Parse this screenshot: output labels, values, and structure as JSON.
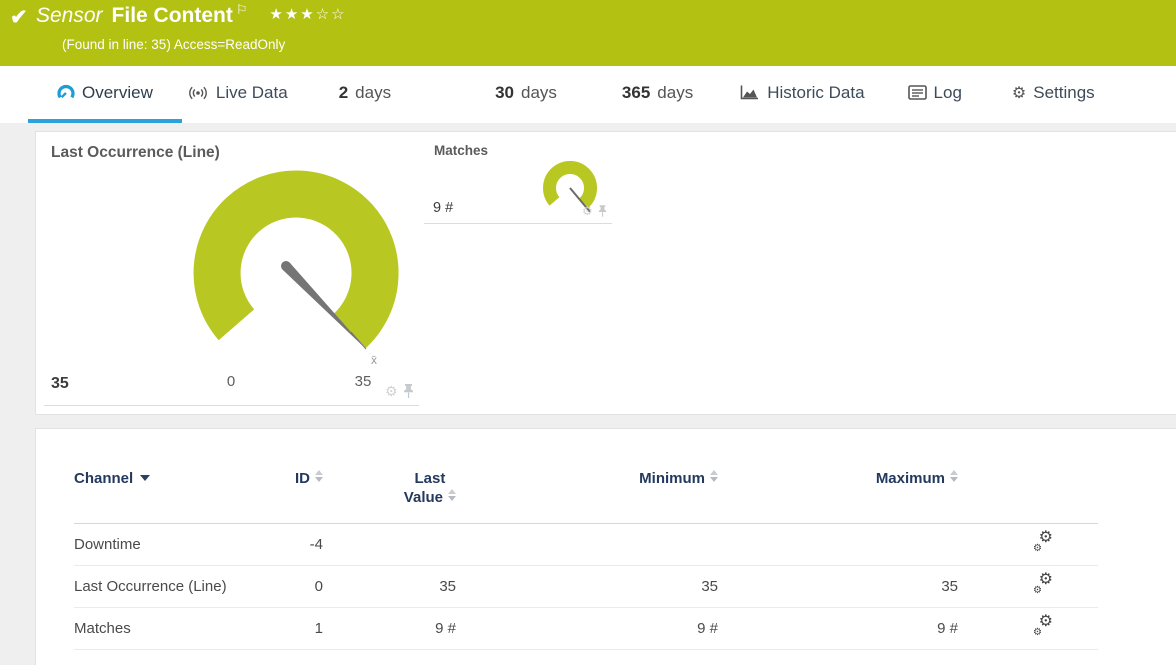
{
  "header": {
    "kind": "Sensor",
    "title": "File Content",
    "stars": "★★★☆☆",
    "stars_filled": 3,
    "stars_total": 5,
    "subtitle": "(Found in line: 35) Access=ReadOnly"
  },
  "tabs": {
    "overview": {
      "label": "Overview"
    },
    "live_data": {
      "label": "Live Data"
    },
    "days2": {
      "num": "2",
      "label": "days"
    },
    "days30": {
      "num": "30",
      "label": "days"
    },
    "days365": {
      "num": "365",
      "label": "days"
    },
    "historic": {
      "label": "Historic Data"
    },
    "log": {
      "label": "Log"
    },
    "settings": {
      "label": "Settings"
    }
  },
  "gauges": {
    "last_occurrence": {
      "title": "Last Occurrence (Line)",
      "value": "35",
      "scale_min": "0",
      "scale_max": "35",
      "avg_marker": "x̄"
    },
    "matches": {
      "title": "Matches",
      "value": "9 #"
    }
  },
  "table": {
    "headers": {
      "channel": "Channel",
      "id": "ID",
      "last_line1": "Last",
      "last_line2": "Value",
      "minimum": "Minimum",
      "maximum": "Maximum"
    },
    "rows": [
      {
        "channel": "Downtime",
        "id": "-4",
        "last": "",
        "min": "",
        "max": ""
      },
      {
        "channel": "Last Occurrence (Line)",
        "id": "0",
        "last": "35",
        "min": "35",
        "max": "35"
      },
      {
        "channel": "Matches",
        "id": "1",
        "last": "9 #",
        "min": "9 #",
        "max": "9 #"
      }
    ]
  },
  "icons": {
    "check": "✔",
    "flag": "⚐",
    "gear": "⚙"
  },
  "colors": {
    "brand_green": "#b3c113",
    "gauge_green": "#b9c722",
    "accent_blue": "#2ba2db",
    "header_navy": "#24395e"
  }
}
